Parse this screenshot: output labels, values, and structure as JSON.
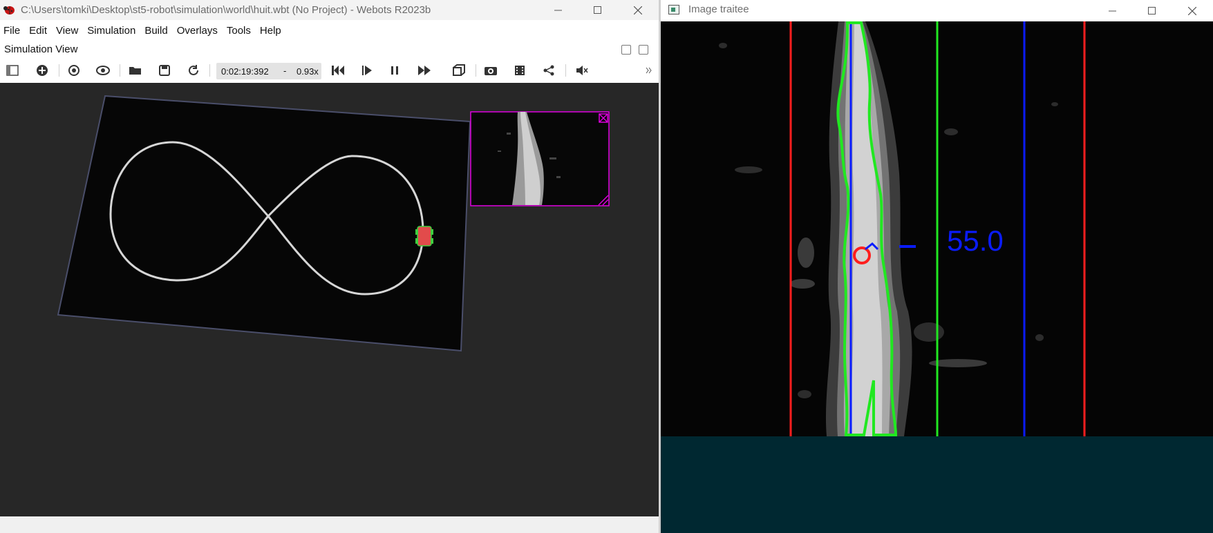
{
  "webots": {
    "title": "C:\\Users\\tomki\\Desktop\\st5-robot\\simulation\\world\\huit.wbt (No Project) - Webots R2023b",
    "menu": [
      "File",
      "Edit",
      "View",
      "Simulation",
      "Build",
      "Overlays",
      "Tools",
      "Help"
    ],
    "panel_title": "Simulation View",
    "simulation_time": "0:02:19:392",
    "time_separator": "-",
    "speed": "0.93x",
    "toolbar_icons": [
      "toggle-scene-tree-icon",
      "add-node-icon",
      "reset-viewpoint-icon",
      "view-eye-icon",
      "open-world-icon",
      "save-world-icon",
      "reload-world-icon",
      "reset-simulation-icon",
      "step-icon",
      "pause-icon",
      "fast-forward-icon",
      "perspective-icon",
      "screenshot-icon",
      "movie-icon",
      "share-icon",
      "sound-mute-icon",
      "more-chevron-icon"
    ]
  },
  "image_window": {
    "title": "Image traitee",
    "angle_label": "-55.0"
  },
  "colors": {
    "viewport_bg": "#272727",
    "floor": "#060606",
    "track": "#d6d6d6",
    "overlay_border": "#e000e0",
    "red_line": "#ff1e1e",
    "blue_line": "#0a1cff",
    "green_contour": "#21e821",
    "desktop_bg": "#002831"
  }
}
